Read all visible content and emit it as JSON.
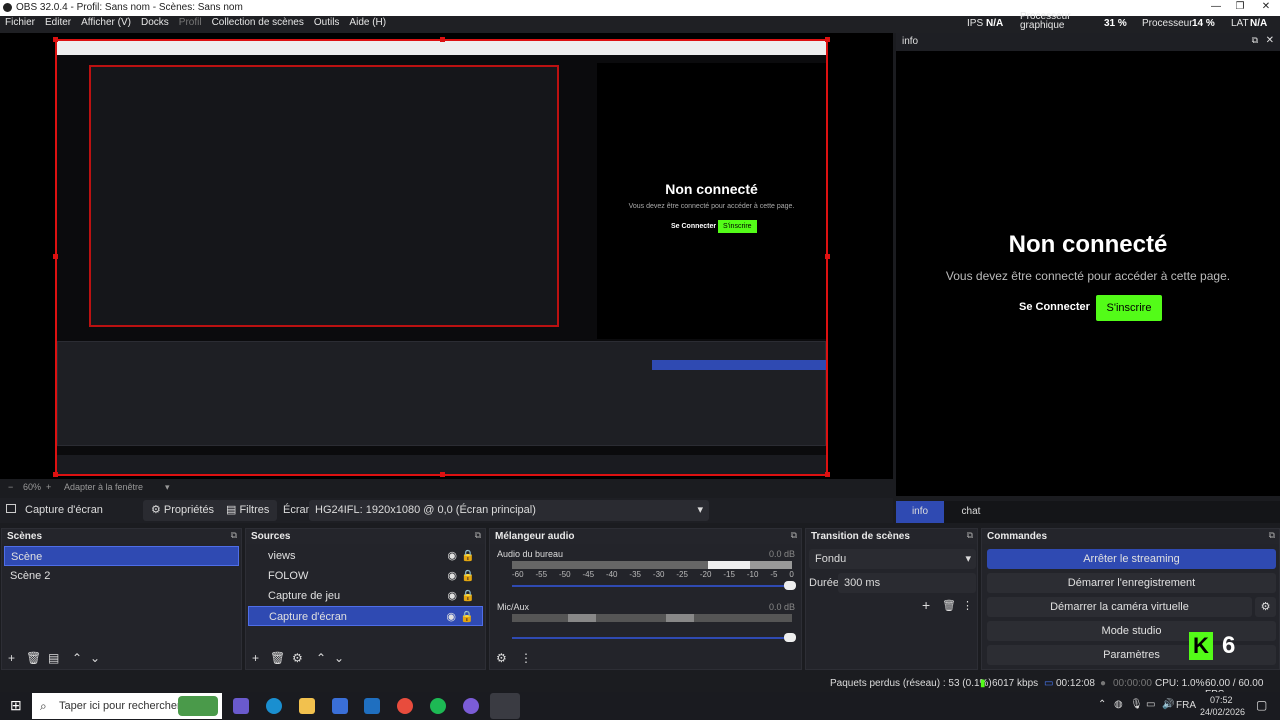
{
  "window": {
    "title": "OBS 32.0.4 - Profil: Sans nom - Scènes: Sans nom"
  },
  "menu": [
    "Fichier",
    "Editer",
    "Afficher (V)",
    "Docks",
    "Profil",
    "Collection de scènes",
    "Outils",
    "Aide (H)"
  ],
  "stats": {
    "ips_label": "IPS",
    "ips_value": "N/A",
    "gpu_label_1": "Processeur",
    "gpu_label_2": "graphique",
    "gpu_value": "31 %",
    "cpu_label": "Processeur",
    "cpu_value": "14 %",
    "lat_label": "LAT",
    "lat_value": "N/A"
  },
  "info_dock": {
    "title": "info",
    "heading": "Non connecté",
    "subtitle": "Vous devez être connecté pour accéder à cette page.",
    "login": "Se Connecter",
    "signup": "S'inscrire",
    "tabs": [
      "info",
      "chat"
    ]
  },
  "preview": {
    "zoom": "60%",
    "fit": "Adapter à la fenêtre"
  },
  "source_bar": {
    "selected": "Capture d'écran",
    "properties": "Propriétés",
    "filters": "Filtres",
    "screen_label": "Écran",
    "screen_value": "HG24IFL: 1920x1080 @ 0,0 (Écran principal)"
  },
  "scenes": {
    "title": "Scènes",
    "items": [
      "Scène",
      "Scène 2"
    ]
  },
  "sources": {
    "title": "Sources",
    "items": [
      "views",
      "FOLOW",
      "Capture de jeu",
      "Capture d'écran"
    ]
  },
  "mixer": {
    "title": "Mélangeur audio",
    "tracks": [
      {
        "name": "Audio du bureau",
        "db": "0.0 dB"
      },
      {
        "name": "Mic/Aux",
        "db": "0.0 dB"
      }
    ],
    "scale": [
      "-60",
      "-55",
      "-50",
      "-45",
      "-40",
      "-35",
      "-30",
      "-25",
      "-20",
      "-15",
      "-10",
      "-5",
      "0"
    ]
  },
  "transitions": {
    "title": "Transition de scènes",
    "type": "Fondu",
    "duration_label": "Durée",
    "duration": "300 ms"
  },
  "controls": {
    "title": "Commandes",
    "buttons": [
      "Arrêter le streaming",
      "Démarrer l'enregistrement",
      "Démarrer la caméra virtuelle",
      "Mode studio",
      "Paramètres"
    ]
  },
  "badge": {
    "letter": "K",
    "number": "6"
  },
  "statusbar": {
    "dropped": "Paquets perdus (réseau) : 53 (0.1%)",
    "bitrate": "6017 kbps",
    "stream_time": "00:12:08",
    "rec_time": "00:00:00",
    "cpu": "CPU: 1.0%",
    "fps": "60.00 / 60.00 FPS"
  },
  "taskbar": {
    "search": "Taper ici pour rechercher",
    "lang": "FRA",
    "time": "07:52",
    "date": "24/02/2026"
  },
  "colors": {
    "accent": "#2f4ab2",
    "kick_green": "#53fc18",
    "record_red": "#d11"
  }
}
